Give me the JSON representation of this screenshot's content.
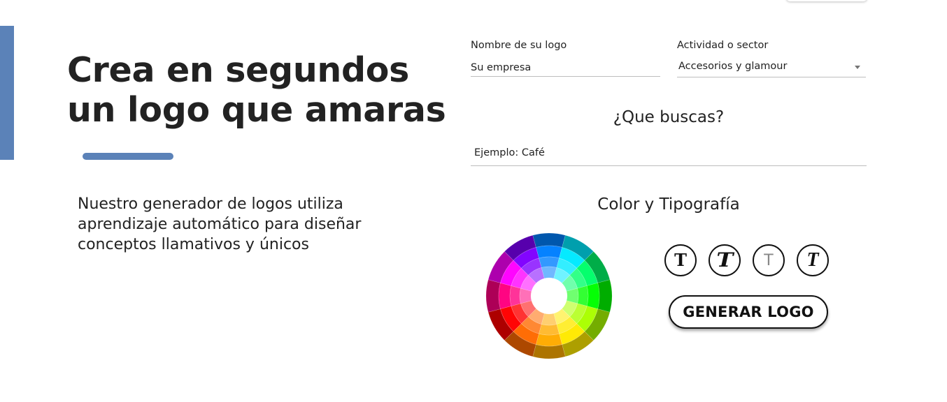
{
  "colors": {
    "accent": "#5b82b8",
    "text": "#222222"
  },
  "hero": {
    "headline_line1": "Crea en segundos",
    "headline_line2": "un logo que amaras",
    "description": "Nuestro generador de logos utiliza aprendizaje automático para diseñar conceptos llamativos y únicos"
  },
  "form": {
    "logo_name": {
      "label": "Nombre de su logo",
      "placeholder": "Su empresa"
    },
    "sector": {
      "label": "Actividad o sector",
      "selected": "Accesorios y glamour"
    },
    "search": {
      "title": "¿Que buscas?",
      "placeholder": "Ejemplo: Café"
    },
    "style": {
      "title": "Color y Tipografía",
      "font_options": [
        {
          "glyph": "T",
          "icon": "bold-serif-font-icon"
        },
        {
          "glyph": "T",
          "icon": "decorative-font-icon"
        },
        {
          "glyph": "T",
          "icon": "thin-font-icon"
        },
        {
          "glyph": "T",
          "icon": "italic-script-font-icon"
        }
      ]
    },
    "generate_label": "GENERAR LOGO"
  }
}
